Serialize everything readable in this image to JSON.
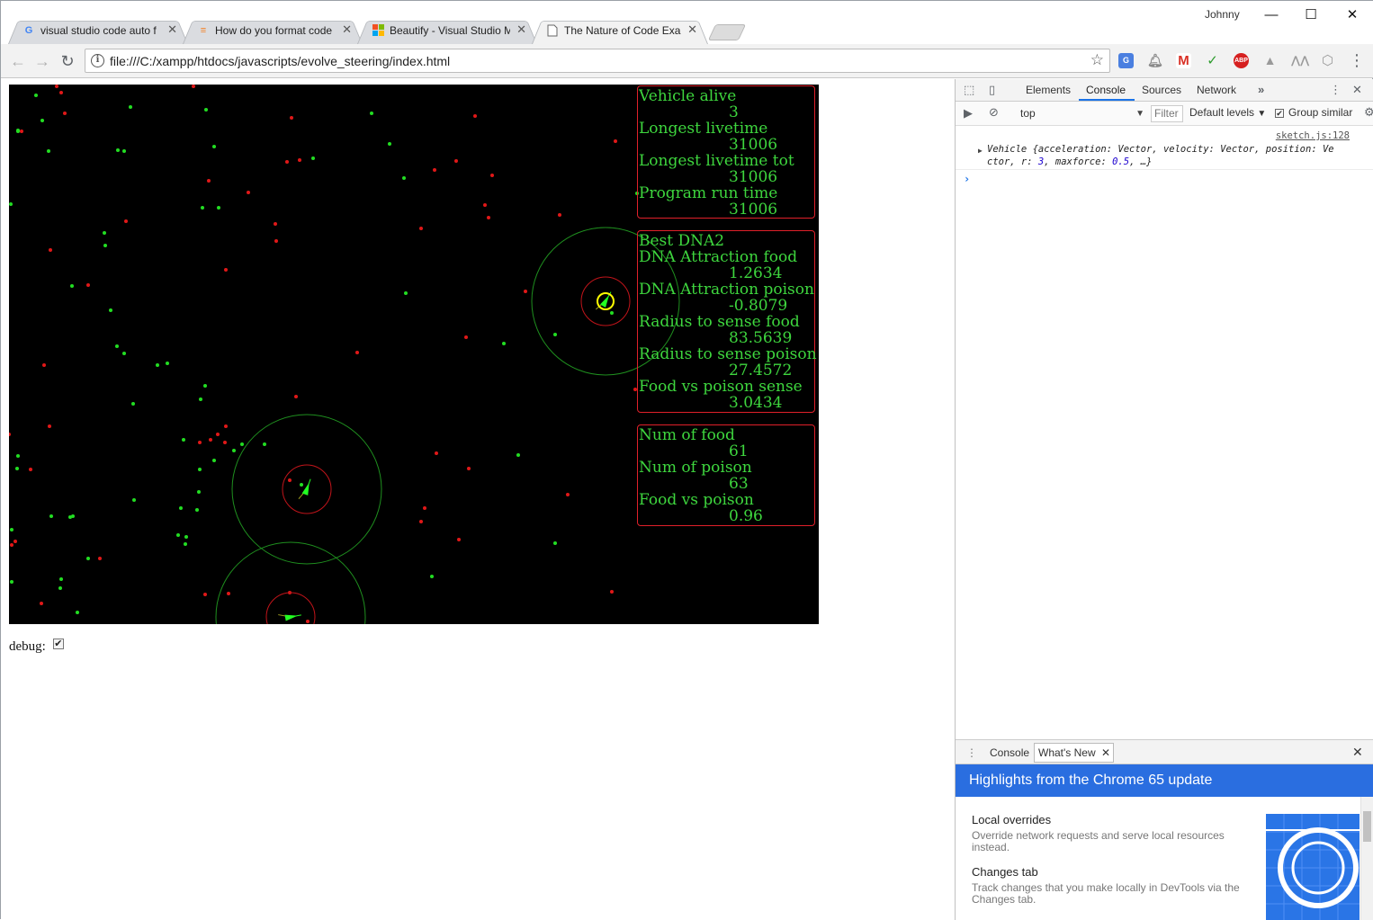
{
  "browser": {
    "tabs": [
      {
        "title": "visual studio code auto f",
        "favicon": "G",
        "color": "#4285f4"
      },
      {
        "title": "How do you format code",
        "favicon": "≡",
        "color": "#f48024"
      },
      {
        "title": "Beautify - Visual Studio M",
        "favicon": "■",
        "color": "#7fba00"
      },
      {
        "title": "The Nature of Code Exan",
        "favicon": "▯",
        "color": "#666666"
      }
    ],
    "user": "Johnny",
    "url": "file:///C:/xampp/htdocs/javascripts/evolve_steering/index.html"
  },
  "stats": {
    "vehicle_alive_label": "Vehicle alive",
    "vehicle_alive": "3",
    "longest_livetime_label": "Longest livetime",
    "longest_livetime": "31006",
    "longest_livetime_tot_label": "Longest livetime tot",
    "longest_livetime_tot": "31006",
    "program_run_time_label": "Program run time",
    "program_run_time": "31006"
  },
  "dna": {
    "title": "Best DNA2",
    "attraction_food_label": "DNA Attraction food",
    "attraction_food": "1.2634",
    "attraction_poison_label": "DNA Attraction poison",
    "attraction_poison": "-0.8079",
    "radius_food_label": "Radius to sense food",
    "radius_food": "83.5639",
    "radius_poison_label": "Radius to sense poison",
    "radius_poison": "27.4572",
    "food_vs_poison_sense_label": "Food vs poison sense",
    "food_vs_poison_sense": "3.0434"
  },
  "counts": {
    "num_food_label": "Num of food",
    "num_food": "61",
    "num_poison_label": "Num of poison",
    "num_poison": "63",
    "food_vs_poison_label": "Food vs poison",
    "food_vs_poison": "0.96"
  },
  "debug": {
    "label": "debug:",
    "checked": true
  },
  "devtools": {
    "tabs": [
      "Elements",
      "Console",
      "Sources",
      "Network"
    ],
    "active_tab": "Console",
    "context": "top",
    "filter_placeholder": "Filter",
    "levels": "Default levels",
    "group_similar": "Group similar",
    "source_link": "sketch.js:128",
    "log_line1": "Vehicle {acceleration: Vector, velocity: Vector, position: Ve",
    "log_line2_a": "ctor, r: ",
    "log_r": "3",
    "log_line2_b": ", maxforce: ",
    "log_maxforce": "0.5",
    "log_line2_c": ", …}",
    "drawer_tabs": [
      "Console",
      "What's New"
    ],
    "banner": "Highlights from the Chrome 65 update",
    "whatsnew": [
      {
        "title": "Local overrides",
        "desc": "Override network requests and serve local resources instead."
      },
      {
        "title": "Changes tab",
        "desc": "Track changes that you make locally in DevTools via the Changes tab."
      }
    ]
  },
  "colors": {
    "food": "#22dd22",
    "poison": "#e01818",
    "text_green": "#3ed63e",
    "panel_border": "#e0202a",
    "accent": "#2a6ee0"
  }
}
